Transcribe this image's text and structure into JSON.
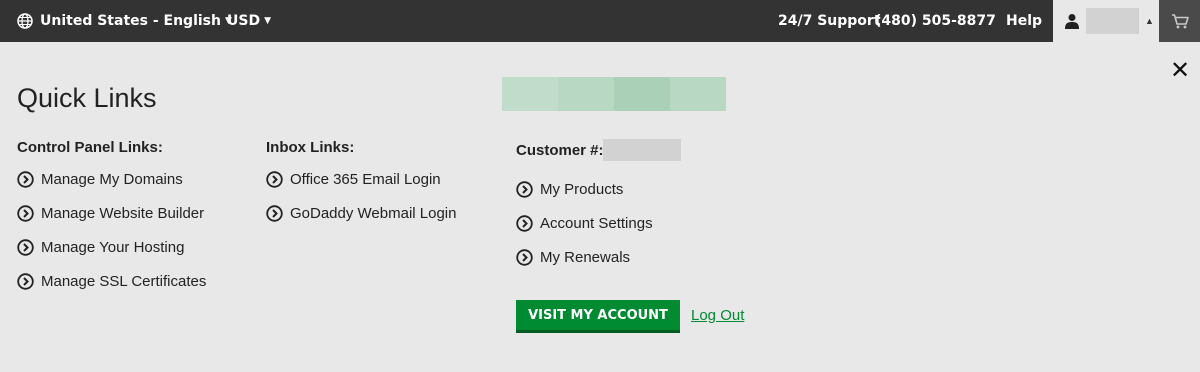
{
  "topbar": {
    "locale_label": "United States - English",
    "currency_label": "USD",
    "support_label": "24/7 Support",
    "support_phone": "(480) 505-8877",
    "help_label": "Help"
  },
  "panel": {
    "title": "Quick Links",
    "control_panel": {
      "heading": "Control Panel Links:",
      "links": [
        "Manage My Domains",
        "Manage Website Builder",
        "Manage Your Hosting",
        "Manage SSL Certificates"
      ]
    },
    "inbox": {
      "heading": "Inbox Links:",
      "links": [
        "Office 365 Email Login",
        "GoDaddy Webmail Login"
      ]
    },
    "account": {
      "customer_label": "Customer #:",
      "links": [
        "My Products",
        "Account Settings",
        "My Renewals"
      ],
      "visit_button": "VISIT MY ACCOUNT",
      "logout_link": "Log Out"
    }
  },
  "colors": {
    "topbar_bg": "#333333",
    "panel_bg": "#e8e8e8",
    "primary_green": "#008a32",
    "redaction_gray": "#d2d2d2",
    "banner_greens": [
      "#c2dccb",
      "#b9d8c4",
      "#abd0b8",
      "#b9d8c4"
    ]
  },
  "icons": {
    "locale": "globe-icon",
    "user": "user-icon",
    "cart": "cart-icon",
    "close": "close-icon",
    "link_bullet": "chevron-circle-right-icon"
  }
}
